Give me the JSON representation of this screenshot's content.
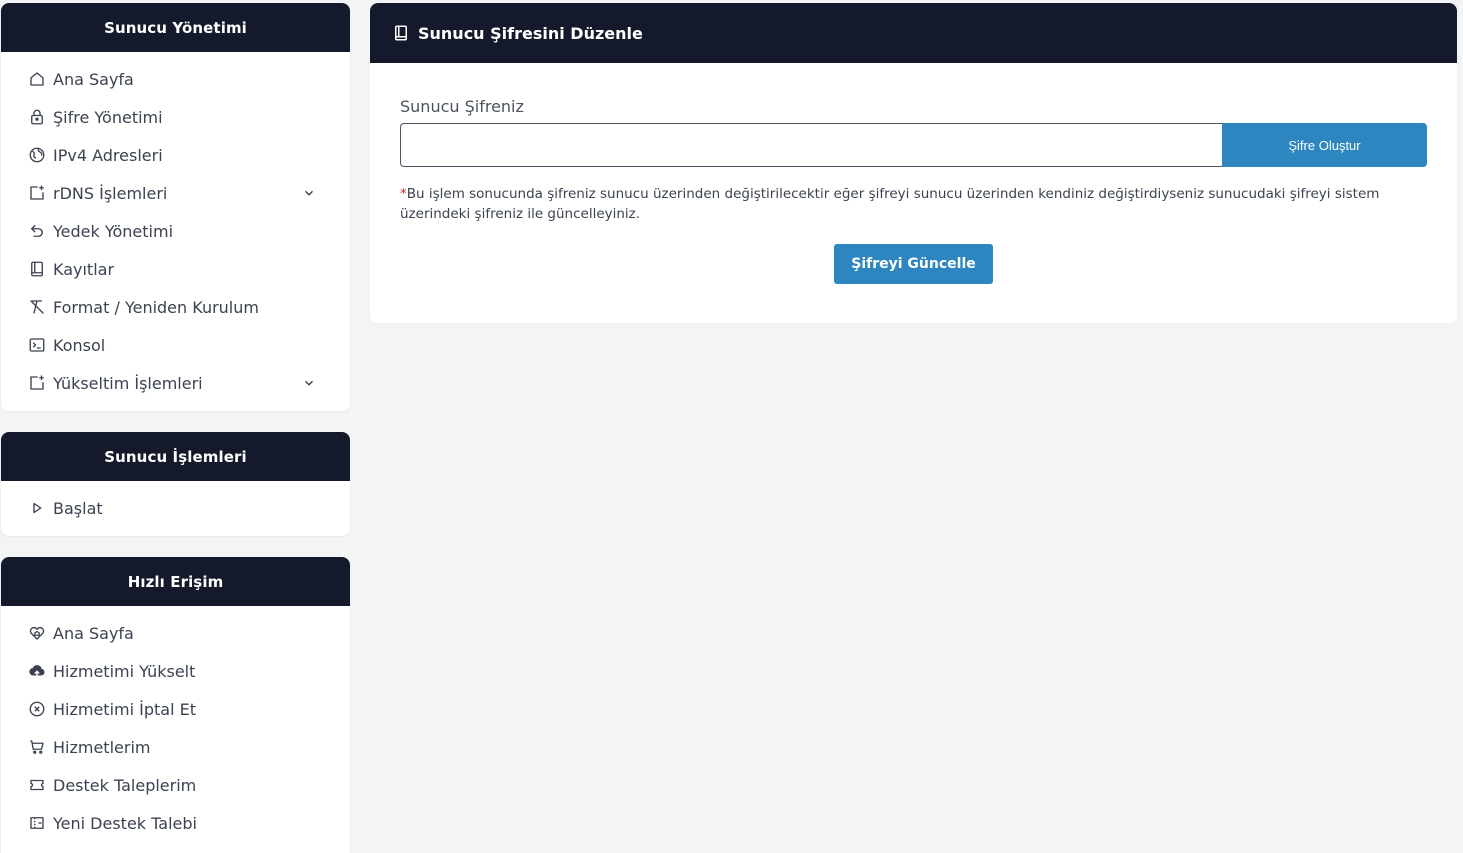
{
  "sidebar_management": {
    "title": "Sunucu Yönetimi",
    "items": [
      {
        "label": "Ana Sayfa",
        "icon": "home-icon"
      },
      {
        "label": "Şifre Yönetimi",
        "icon": "lock-icon"
      },
      {
        "label": "IPv4 Adresleri",
        "icon": "globe-icon"
      },
      {
        "label": "rDNS İşlemleri",
        "icon": "add-box-icon",
        "expandable": true
      },
      {
        "label": "Yedek Yönetimi",
        "icon": "undo-icon"
      },
      {
        "label": "Kayıtlar",
        "icon": "book-icon"
      },
      {
        "label": "Format / Yeniden Kurulum",
        "icon": "clear-format-icon"
      },
      {
        "label": "Konsol",
        "icon": "terminal-icon"
      },
      {
        "label": "Yükseltim İşlemleri",
        "icon": "add-box-icon",
        "expandable": true
      }
    ]
  },
  "sidebar_operations": {
    "title": "Sunucu İşlemleri",
    "items": [
      {
        "label": "Başlat",
        "icon": "play-icon"
      }
    ]
  },
  "sidebar_quick": {
    "title": "Hızlı Erişim",
    "items": [
      {
        "label": "Ana Sayfa",
        "icon": "heart-home-icon"
      },
      {
        "label": "Hizmetimi Yükselt",
        "icon": "cloud-upload-icon"
      },
      {
        "label": "Hizmetimi İptal Et",
        "icon": "cancel-circle-icon"
      },
      {
        "label": "Hizmetlerim",
        "icon": "cart-icon"
      },
      {
        "label": "Destek Taleplerim",
        "icon": "ticket-icon"
      },
      {
        "label": "Yeni Destek Talebi",
        "icon": "new-ticket-icon"
      }
    ]
  },
  "main": {
    "title": "Sunucu Şifresini Düzenle",
    "field_label": "Sunucu Şifreniz",
    "password_value": "",
    "generate_button": "Şifre Oluştur",
    "note_star": "*",
    "note_text": "Bu işlem sonucunda şifreniz sunucu üzerinden değiştirilecektir eğer şifreyi sunucu üzerinden kendiniz değiştirdiyseniz sunucudaki şifreyi sistem üzerindeki şifreniz ile güncelleyiniz.",
    "update_button": "Şifreyi Güncelle"
  },
  "colors": {
    "header_bg": "#141a2b",
    "accent": "#2e86c1",
    "page_bg": "#f3f4f6",
    "warning_star": "#dc2626"
  }
}
